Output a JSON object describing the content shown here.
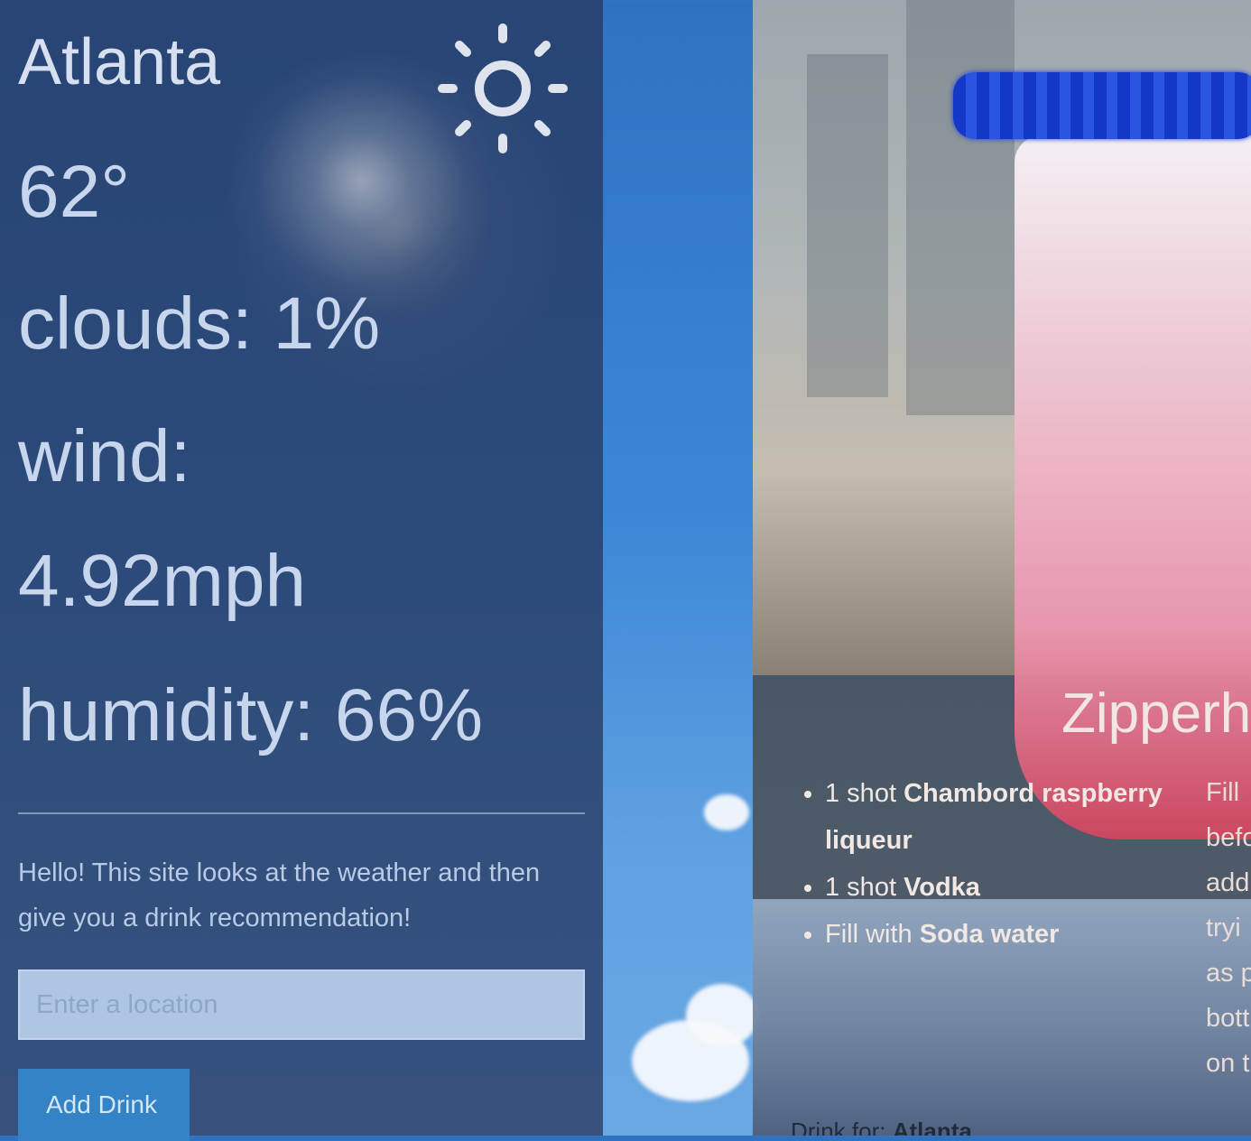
{
  "weather": {
    "city": "Atlanta",
    "temperature": "62°",
    "clouds": "clouds: 1%",
    "wind_label": "wind:",
    "wind_value": "4.92mph",
    "humidity": "humidity: 66%",
    "condition_icon": "sun-icon"
  },
  "intro": {
    "text": "Hello! This site looks at the weather and then give you a drink recommendation!"
  },
  "location_input": {
    "placeholder": "Enter a location",
    "value": ""
  },
  "add_drink_button": {
    "label": "Add Drink"
  },
  "drink": {
    "title": "Zipperh",
    "ingredients": [
      {
        "amount": "1 shot",
        "name": "Chambord raspberry liqueur"
      },
      {
        "amount": "1 shot",
        "name": "Vodka"
      },
      {
        "amount": "Fill with",
        "name": "Soda water"
      }
    ],
    "instructions_lines": [
      "Fill",
      "befo",
      "add",
      "tryi",
      "as p",
      "bott",
      "on t"
    ],
    "drink_for_label": "Drink for:",
    "drink_for_city": "Atlanta"
  },
  "colors": {
    "panel_bg": "#26385f",
    "panel_text": "#c7d6ec",
    "button_bg": "#3483c6",
    "input_bg": "#aec6e4"
  }
}
